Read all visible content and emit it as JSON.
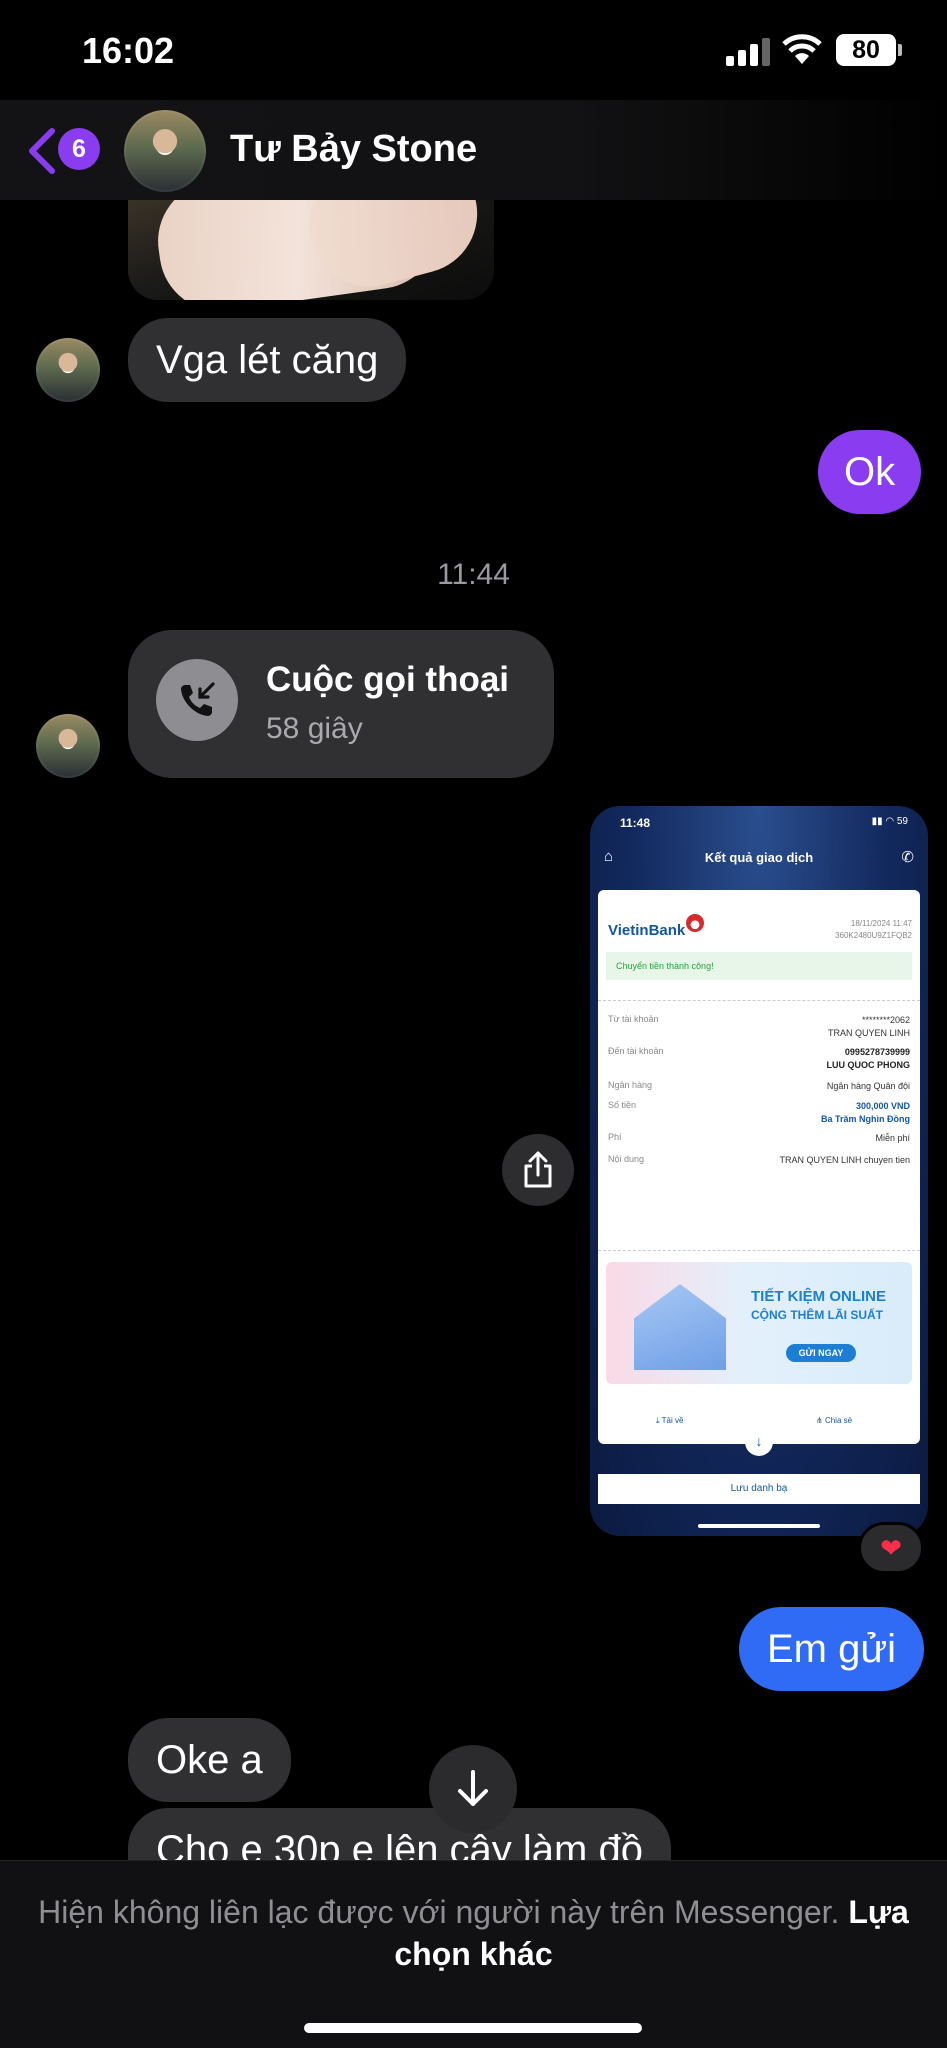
{
  "status_bar": {
    "time": "16:02",
    "battery": "80"
  },
  "header": {
    "back_badge": "6",
    "contact_name": "Tư Bảy Stone"
  },
  "messages": {
    "m1": "Vga lét căng",
    "m2": "Ok",
    "timestamp": "11:44",
    "call_title": "Cuộc gọi thoại",
    "call_duration": "58 giây",
    "m3": "Em gửi",
    "m4": "Oke a",
    "m5": "Cho e 30p e lên cây làm đồ"
  },
  "receipt": {
    "time": "11:48",
    "battery": "59",
    "title": "Kết quả giao dịch",
    "bank": "VietinBank",
    "date": "18/11/2024 11:47",
    "ref": "360K2480U9Z1FQB2",
    "success": "Chuyển tiền thành công!",
    "from_label": "Từ tài khoản",
    "from_acc": "********2062",
    "from_name": "TRAN QUYEN LINH",
    "to_label": "Đến tài khoản",
    "to_acc": "0995278739999",
    "to_name": "LUU QUOC PHONG",
    "bank_label": "Ngân hàng",
    "bank_value": "Ngân hàng Quân đội",
    "amount_label": "Số tiền",
    "amount": "300,000 VND",
    "amount_words": "Ba Trăm Nghìn Đồng",
    "fee_label": "Phí",
    "fee": "Miễn phí",
    "content_label": "Nội dung",
    "content": "TRAN QUYEN LINH chuyen tien",
    "promo_line1": "TIẾT KIỆM ONLINE",
    "promo_line2": "CỘNG THÊM LÃI SUẤT",
    "promo_button": "GỬI NGAY",
    "download": "Tải về",
    "share": "Chia sẻ",
    "save_contact": "Lưu danh bạ"
  },
  "footer": {
    "notice": "Hiện không liên lạc được với người này trên Messenger.",
    "link": "Lựa chọn khác"
  },
  "colors": {
    "accent": "#8a3cf0",
    "outgoing_blue": "#2f6bf5",
    "incoming": "#303033"
  }
}
